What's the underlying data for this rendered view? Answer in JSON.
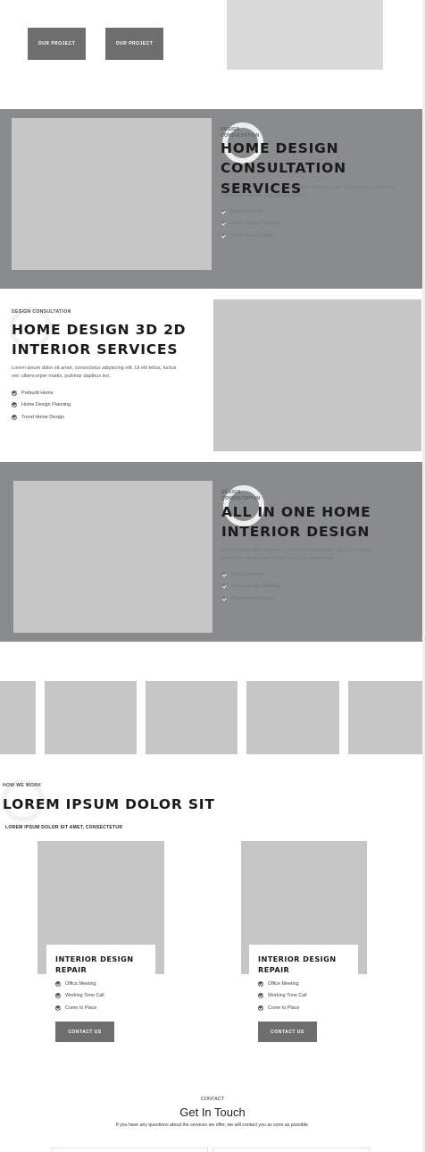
{
  "hero": {
    "buttons": [
      "OUR PROJECT",
      "OUR PROJECT"
    ]
  },
  "section1": {
    "eyebrow": "DESIGN CONSULTATION",
    "title_lines": [
      "HOME DESIGN",
      "CONSULTATION",
      "SERVICES"
    ],
    "description": "Lorem ipsum dolor sit amet, consectetur adipiscing elit. Ut elit tellus, luctus nec ullamcorper mattis, pulvinar dapibus leo.",
    "list": [
      "Prebuild Home",
      "Home Design Planning",
      "Trend Home Design"
    ]
  },
  "section2": {
    "eyebrow": "DESIGN CONSULTATION",
    "title_lines": [
      "HOME DESIGN 3D 2D",
      "INTERIOR SERVICES"
    ],
    "description_lines": [
      "Lorem ipsum dolor sit amet, consectetur adipiscing elit. Ut elit tellus, luctus",
      "nec ullamcorper mattis, pulvinar dapibus leo."
    ],
    "list": [
      "Prebuild Home",
      "Home Design Planning",
      "Trend Home Design"
    ]
  },
  "section3": {
    "eyebrow": "DESIGN CONSULTATION",
    "title_lines": [
      "ALL IN ONE HOME",
      "INTERIOR DESIGN"
    ],
    "description_lines": [
      "Lorem ipsum dolor sit amet, consectetur adipiscing elit. Ut elit tellus,",
      "luctus nec ullamcorper mattis, pulvinar dapibus leo."
    ],
    "list": [
      "Prebuild Home",
      "Home Design Planning",
      "Trend Home Design"
    ]
  },
  "how_we_work": {
    "eyebrow": "HOW WE WORK",
    "title": "LOREM IPSUM DOLOR SIT",
    "subtitle": "LOREM IPSUM DOLOR SIT AMET, CONSECTETUR"
  },
  "cards": [
    {
      "title_lines": [
        "INTERIOR DESIGN",
        "REPAIR"
      ],
      "list": [
        "Office Meeting",
        "Working Time Call",
        "Come to Place"
      ],
      "button": "CONTACT US"
    },
    {
      "title_lines": [
        "INTERIOR DESIGN",
        "REPAIR"
      ],
      "list": [
        "Office Meeting",
        "Working Time Call",
        "Come to Place"
      ],
      "button": "CONTACT US"
    }
  ],
  "contact": {
    "eyebrow": "CONTACT",
    "title": "Get In Touch",
    "description": "If you have any questions about the services we offer, we will contact you as soon as possible."
  },
  "colors": {
    "band": "#898b8d",
    "button": "#6e6e6e",
    "placeholder": "#c6c6c6"
  }
}
